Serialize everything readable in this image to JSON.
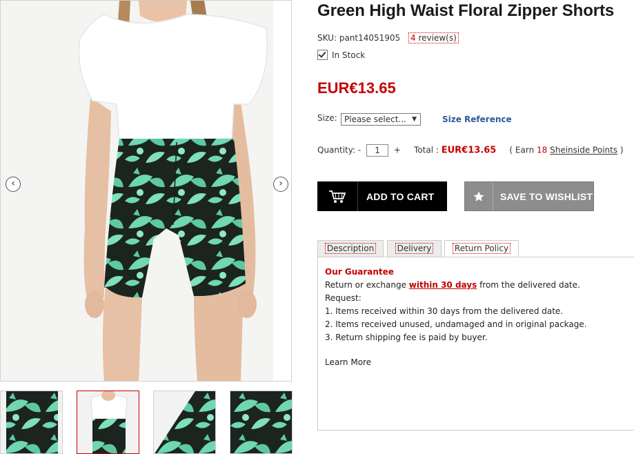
{
  "product": {
    "title": "Green High Waist Floral Zipper Shorts",
    "sku_label": "SKU:",
    "sku": "pant14051905",
    "review_count": "4",
    "review_suffix": " review(s)",
    "stock_status": "In Stock",
    "price": "EUR€13.65"
  },
  "options": {
    "size_label": "Size:",
    "size_selected": "Please select...",
    "size_reference": "Size Reference",
    "quantity_label": "Quantity:",
    "qty_minus": "-",
    "qty_value": "1",
    "qty_plus": "+",
    "total_label": "Total :",
    "total_price": "EUR€13.65",
    "earn_prefix": "( Earn ",
    "earn_points": "18",
    "earn_link": "Sheinside Points",
    "earn_suffix": " )"
  },
  "buttons": {
    "add_to_cart": "ADD TO CART",
    "save_to_wishlist": "SAVE TO WISHLIST"
  },
  "gallery": {
    "prev_arrow": "‹",
    "next_arrow": "›"
  },
  "tabs": {
    "description": "Description",
    "delivery": "Delivery",
    "return_policy": "Return Policy"
  },
  "return_policy": {
    "heading": "Our Guarantee",
    "line1_pre": "Return or exchange ",
    "line1_highlight": "within 30 days",
    "line1_post": " from the delivered date.",
    "request_label": "Request:",
    "item1": "1. Items received within  30 days from the delivered date.",
    "item2": "2. Items received unused, undamaged and in original package.",
    "item3": "3. Return shipping fee is paid by buyer.",
    "learn_more": "Learn More"
  },
  "colors": {
    "accent_red": "#c40000",
    "link_blue": "#2b5b9c",
    "cart_button": "#000000",
    "wishlist_button": "#8d8d8d",
    "shorts_mint": "#6fd8b0",
    "shorts_dark": "#1c2420"
  },
  "icons": {
    "cart": "shopping-cart-icon",
    "wishlist": "star-icon",
    "in_stock": "checkbox-checked-icon",
    "prev": "chevron-left-icon",
    "next": "chevron-right-icon"
  }
}
